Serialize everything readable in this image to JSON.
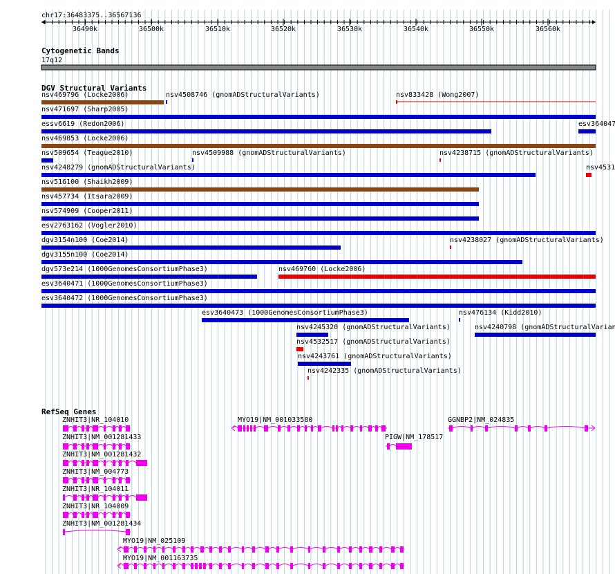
{
  "colors": {
    "grid": "#b4d4e4",
    "loss": "#0000cc",
    "gain": "#ee0000",
    "complex": "#8b4513",
    "gene": "#ee00ee",
    "band": "#888888"
  },
  "ruler": {
    "location": "chr17:36483375..36567136",
    "ticks": [
      "36490k",
      "36500k",
      "36510k",
      "36520k",
      "36530k",
      "36540k",
      "36550k",
      "36560k"
    ]
  },
  "cytobands": {
    "title": "Cytogenetic Bands",
    "band": "17q12"
  },
  "dgv": {
    "title": "DGV Structural Variants",
    "features": [
      {
        "label": "nsv469796 (Locke2006)",
        "kind": "complex"
      },
      {
        "label": "nsv4508746 (gnomADStructuralVariants)",
        "kind": "loss"
      },
      {
        "label": "nsv833428 (Wong2007)",
        "kind": "gain"
      },
      {
        "label": "nsv471697 (Sharp2005)",
        "kind": "loss"
      },
      {
        "label": "essv6619 (Redon2006)",
        "kind": "loss"
      },
      {
        "label": "esv364047",
        "kind": "loss"
      },
      {
        "label": "nsv469853 (Locke2006)",
        "kind": "complex"
      },
      {
        "label": "nsv509654 (Teague2010)",
        "kind": "loss"
      },
      {
        "label": "nsv4509988 (gnomADStructuralVariants)",
        "kind": "loss"
      },
      {
        "label": "nsv4238715 (gnomADStructuralVariants)",
        "kind": "gain"
      },
      {
        "label": "nsv4248279 (gnomADStructuralVariants)",
        "kind": "loss"
      },
      {
        "label": "nsv4531",
        "kind": "gain"
      },
      {
        "label": "nsv516100 (Shaikh2009)",
        "kind": "complex"
      },
      {
        "label": "nsv457734 (Itsara2009)",
        "kind": "loss"
      },
      {
        "label": "nsv574909 (Cooper2011)",
        "kind": "loss"
      },
      {
        "label": "esv2763162 (Vogler2010)",
        "kind": "loss"
      },
      {
        "label": "dgv3154n100 (Coe2014)",
        "kind": "loss"
      },
      {
        "label": "nsv4238027 (gnomADStructuralVariants)",
        "kind": "gain"
      },
      {
        "label": "dgv3155n100 (Coe2014)",
        "kind": "loss"
      },
      {
        "label": "dgv573e214 (1000GenomesConsortiumPhase3)",
        "kind": "loss"
      },
      {
        "label": "nsv469760 (Locke2006)",
        "kind": "gain"
      },
      {
        "label": "esv3640471 (1000GenomesConsortiumPhase3)",
        "kind": "loss"
      },
      {
        "label": "esv3640472 (1000GenomesConsortiumPhase3)",
        "kind": "loss"
      },
      {
        "label": "esv3640473 (1000GenomesConsortiumPhase3)",
        "kind": "loss"
      },
      {
        "label": "nsv476134 (Kidd2010)",
        "kind": "loss"
      },
      {
        "label": "nsv4245320 (gnomADStructuralVariants)",
        "kind": "loss"
      },
      {
        "label": "nsv4240798 (gnomADStructuralVarian",
        "kind": "loss"
      },
      {
        "label": "nsv4532517 (gnomADStructuralVariants)",
        "kind": "gain"
      },
      {
        "label": "nsv4243761 (gnomADStructuralVariants)",
        "kind": "loss"
      },
      {
        "label": "nsv4242335 (gnomADStructuralVariants)",
        "kind": "gain"
      }
    ]
  },
  "refseq": {
    "title": "RefSeq Genes",
    "genes": [
      {
        "label": "ZNHIT3|NR_104010"
      },
      {
        "label": "MYO19|NM_001033580"
      },
      {
        "label": "GGNBP2|NM_024835"
      },
      {
        "label": "ZNHIT3|NM_001281433"
      },
      {
        "label": "PIGW|NM_178517"
      },
      {
        "label": "ZNHIT3|NM_001281432"
      },
      {
        "label": "ZNHIT3|NM_004773"
      },
      {
        "label": "ZNHIT3|NR_104011"
      },
      {
        "label": "ZNHIT3|NR_104009"
      },
      {
        "label": "ZNHIT3|NM_001281434"
      },
      {
        "label": "MYO19|NM_025109"
      },
      {
        "label": "MYO19|NM_001163735"
      }
    ]
  }
}
